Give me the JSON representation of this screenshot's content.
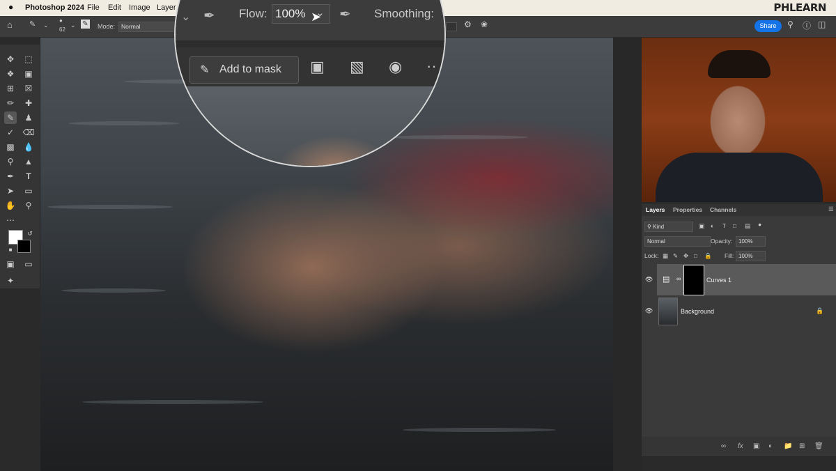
{
  "menubar": {
    "apple": "",
    "app_name": "Photoshop 2024",
    "items": [
      "File",
      "Edit",
      "Image",
      "Layer"
    ],
    "brand": "PHLEARN"
  },
  "options_bar": {
    "brush_size": "62",
    "mode_label": "Mode:",
    "mode_value": "Normal",
    "share_label": "Share"
  },
  "magnifier": {
    "flow_label": "Flow:",
    "flow_value": "100%",
    "smoothing_label": "Smoothing:",
    "add_to_mask_label": "Add to mask",
    "more": "··"
  },
  "layers_panel": {
    "tabs": [
      "Layers",
      "Properties",
      "Channels"
    ],
    "active_tab": "Layers",
    "kind_label": "Kind",
    "blend_mode": "Normal",
    "opacity_label": "Opacity:",
    "opacity_value": "100%",
    "lock_label": "Lock:",
    "fill_label": "Fill:",
    "fill_value": "100%",
    "layers": [
      {
        "name": "Curves 1",
        "selected": true
      },
      {
        "name": "Background",
        "selected": false
      }
    ]
  },
  "colors": {
    "accent": "#1473e6",
    "menubar": "#f1ece1",
    "panel": "#3a3a3a"
  }
}
